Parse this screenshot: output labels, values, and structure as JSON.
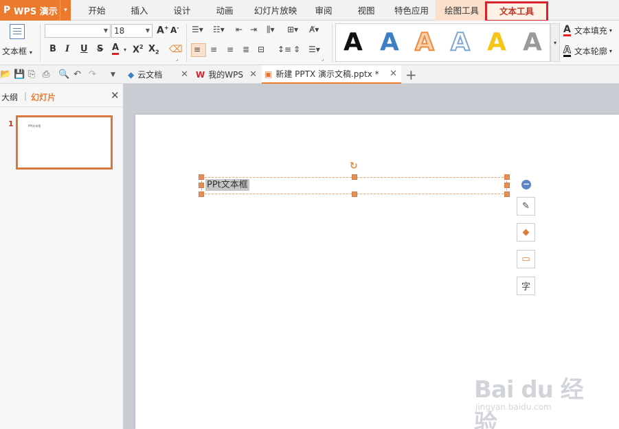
{
  "app": {
    "logo": "P",
    "name": "WPS 演示",
    "caret": "▾"
  },
  "menu": {
    "tabs": [
      "开始",
      "插入",
      "设计",
      "动画",
      "幻灯片放映",
      "审阅",
      "视图",
      "特色应用",
      "绘图工具",
      "文本工具"
    ],
    "active": "文本工具"
  },
  "ribbon": {
    "textbox_label": "文本框",
    "font_name": "",
    "font_size": "18",
    "wordart_letter": "A",
    "wordart_styles": [
      {
        "color": "#111111",
        "style": "black"
      },
      {
        "color": "#3d7fc4",
        "style": "blue"
      },
      {
        "color": "#f08a3c",
        "style": "orange-outline"
      },
      {
        "color": "#7aa6d6",
        "style": "blue-outline"
      },
      {
        "color": "#f5c518",
        "style": "yellow"
      },
      {
        "color": "#8a8a8a",
        "style": "gray"
      }
    ],
    "text_fill_label": "文本填充",
    "text_outline_label": "文本轮廓",
    "icons": [
      "bold",
      "italic",
      "underline",
      "strikethrough",
      "font-color",
      "superscript",
      "subscript",
      "clear-format",
      "bullets",
      "numbering",
      "indent-decrease",
      "indent-increase",
      "align-left",
      "align-center",
      "align-right",
      "justify",
      "distribute",
      "line-spacing",
      "text-direction"
    ]
  },
  "quick": {
    "doc_tabs": [
      {
        "label": "云文档",
        "icon": "cloud-cube-icon"
      },
      {
        "label": "我的WPS",
        "icon": "wps-w-icon"
      },
      {
        "label": "新建 PPTX 演示文稿.pptx *",
        "icon": "pptx-doc-icon",
        "active": true
      }
    ]
  },
  "panel": {
    "outline_label": "大纲",
    "divider": "|",
    "slides_label": "幻灯片",
    "close": "✕",
    "slide_number": "1",
    "thumb_text": "PPt文本框"
  },
  "slide": {
    "textbox_text": "PPt文本框"
  },
  "side_tools": [
    "edit-shape-icon",
    "fill-icon",
    "outline-icon",
    "text-icon"
  ],
  "side_tool_labels": {
    "text": "字"
  },
  "watermark": {
    "main": "Bai du 经验",
    "sub": "jingyan.baidu.com"
  },
  "colors": {
    "accent": "#ec7a2c",
    "highlight": "#d6202c"
  }
}
